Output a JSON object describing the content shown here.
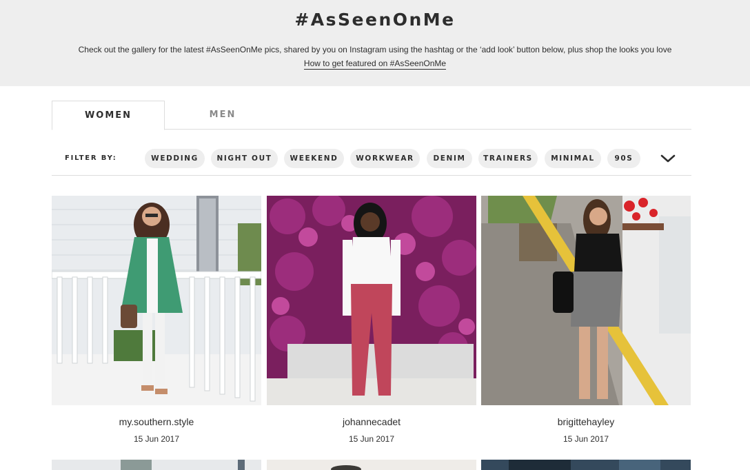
{
  "hero": {
    "title": "#AsSeenOnMe",
    "description": "Check out the gallery for the latest #AsSeenOnMe pics, shared by you on Instagram using the hashtag or the ‘add look’ button below, plus shop the looks you love",
    "featured_link": "How to get featured on #AsSeenOnMe"
  },
  "tabs": [
    {
      "label": "WOMEN",
      "active": true
    },
    {
      "label": "MEN",
      "active": false
    }
  ],
  "filter": {
    "label": "FILTER BY:",
    "pills": [
      "WEDDING",
      "NIGHT OUT",
      "WEEKEND",
      "WORKWEAR",
      "DENIM",
      "TRAINERS",
      "MINIMAL",
      "90S"
    ],
    "expand_icon": "chevron-down-icon"
  },
  "posts": [
    {
      "username": "my.southern.style",
      "date": "15 Jun 2017"
    },
    {
      "username": "johannecadet",
      "date": "15 Jun 2017"
    },
    {
      "username": "brigittehayley",
      "date": "15 Jun 2017"
    }
  ],
  "colors": {
    "hero_bg": "#eeeeee",
    "pill_bg": "#eeeeee",
    "text": "#2d2d2d",
    "inactive_tab": "#8a8a8a"
  }
}
